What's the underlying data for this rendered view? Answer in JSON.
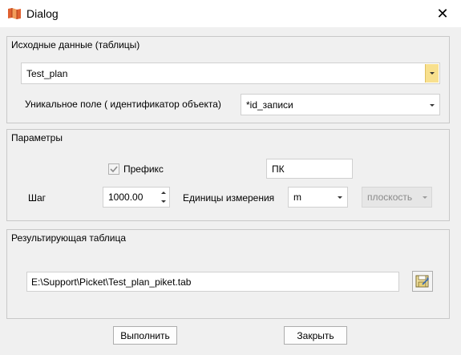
{
  "window": {
    "title": "Dialog"
  },
  "source": {
    "group_title": "Исходные данные (таблицы)",
    "table_value": "Test_plan",
    "unique_field_label": "Уникальное поле ( идентификатор объекта)",
    "unique_field_value": "*id_записи"
  },
  "params": {
    "group_title": "Параметры",
    "prefix_checked": true,
    "prefix_label": "Префикс",
    "prefix_value": "ПК",
    "step_label": "Шаг",
    "step_value": "1000.00",
    "units_label": "Единицы измерения",
    "units_value": "m",
    "plane_value": "плоскость"
  },
  "result": {
    "group_title": "Результирующая таблица",
    "path_value": "E:\\Support\\Picket\\Test_plan_piket.tab"
  },
  "buttons": {
    "run_label": "Выполнить",
    "close_label": "Закрыть"
  },
  "colors": {
    "accent_dropdown": "#f8e08e",
    "window_bg": "#f0f0f0"
  }
}
